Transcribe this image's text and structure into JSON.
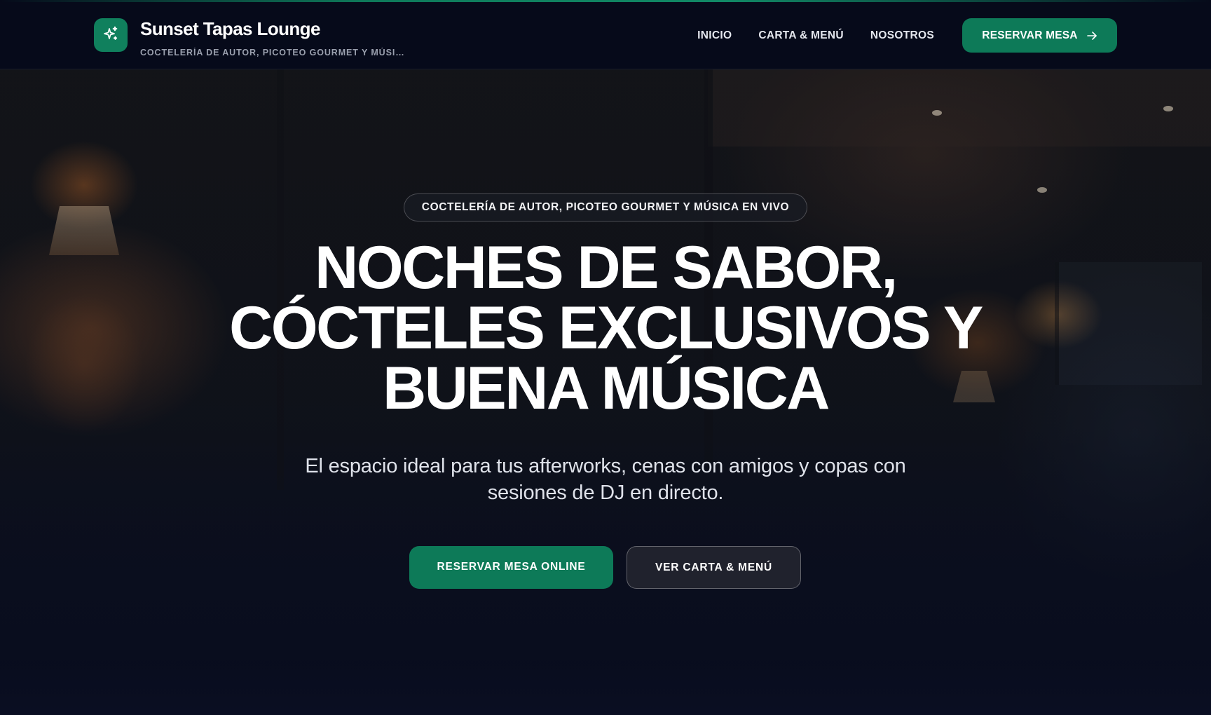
{
  "colors": {
    "accent": "#0d7a58",
    "header_bg": "#060a1a",
    "text": "#ffffff",
    "muted": "#9aa0ae"
  },
  "header": {
    "brand_icon": "sparkles-icon",
    "brand_title": "Sunset Tapas Lounge",
    "brand_subtitle": "COCTELERÍA DE AUTOR, PICOTEO GOURMET Y MÚSICA EN VIVO",
    "nav": [
      {
        "label": "INICIO"
      },
      {
        "label": "CARTA & MENÚ"
      },
      {
        "label": "NOSOTROS"
      }
    ],
    "cta_label": "RESERVAR MESA",
    "cta_icon": "arrow-right-icon"
  },
  "hero": {
    "badge": "COCTELERÍA DE AUTOR, PICOTEO GOURMET Y MÚSICA EN VIVO",
    "headline_lines": [
      "NOCHES DE SABOR,",
      "CÓCTELES EXCLUSIVOS Y",
      "BUENA MÚSICA"
    ],
    "lede": "El espacio ideal para tus afterworks, cenas con amigos y copas con sesiones de DJ en directo.",
    "primary_button": "RESERVAR MESA ONLINE",
    "secondary_button": "VER CARTA & MENÚ"
  }
}
